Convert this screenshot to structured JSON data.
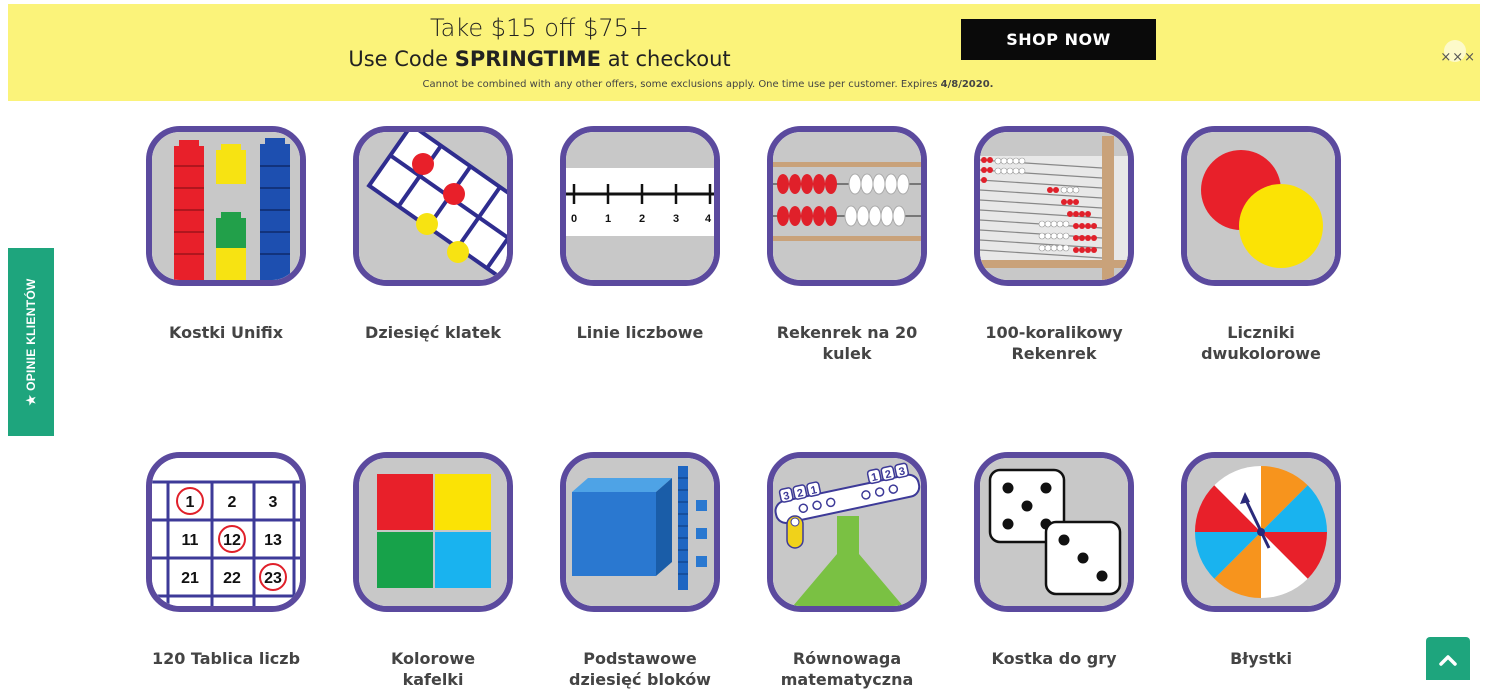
{
  "promo": {
    "headline": "Take $15 off $75+",
    "code_prefix": "Use Code ",
    "code": "SPRINGTIME",
    "code_suffix": " at checkout",
    "fine_print": "Cannot be combined with any other offers, some  exclusions apply. One time use per customer. Expires ",
    "expiry": "4/8/2020.",
    "shop_label": "SHOP NOW",
    "close_label": "×××"
  },
  "side_tab": {
    "label": "★ OPINIE KLIENTÓW"
  },
  "tiles": [
    {
      "label": "Kostki Unifix",
      "icon": "unifix-cubes-icon"
    },
    {
      "label": "Dziesięć klatek",
      "icon": "ten-frame-icon"
    },
    {
      "label": "Linie liczbowe",
      "icon": "number-line-icon"
    },
    {
      "label": "Rekenrek na 20 kulek",
      "icon": "rekenrek-20-icon"
    },
    {
      "label": "100-koralikowy Rekenrek",
      "icon": "rekenrek-100-icon"
    },
    {
      "label": "Liczniki dwukolorowe",
      "icon": "two-color-counters-icon"
    },
    {
      "label": "120 Tablica liczb",
      "icon": "number-chart-icon"
    },
    {
      "label": "Kolorowe kafelki",
      "icon": "color-tiles-icon"
    },
    {
      "label": "Podstawowe dziesięć bloków",
      "icon": "base-ten-blocks-icon"
    },
    {
      "label": "Równowaga matematyczna",
      "icon": "math-balance-icon"
    },
    {
      "label": "Kostka do gry",
      "icon": "dice-icon"
    },
    {
      "label": "Błystki",
      "icon": "spinner-icon"
    }
  ],
  "number_line": {
    "ticks": [
      "0",
      "1",
      "2",
      "3",
      "4"
    ]
  },
  "number_chart": {
    "cells": [
      "1",
      "2",
      "3",
      "11",
      "12",
      "13",
      "21",
      "22",
      "23"
    ]
  },
  "balance": {
    "left_digits": [
      "3",
      "2",
      "1"
    ],
    "right_digits": [
      "1",
      "2",
      "3"
    ]
  },
  "colors": {
    "banner_bg": "#fbf37a",
    "accent_green": "#1ea57d",
    "tile_border": "#5b4a9e"
  }
}
